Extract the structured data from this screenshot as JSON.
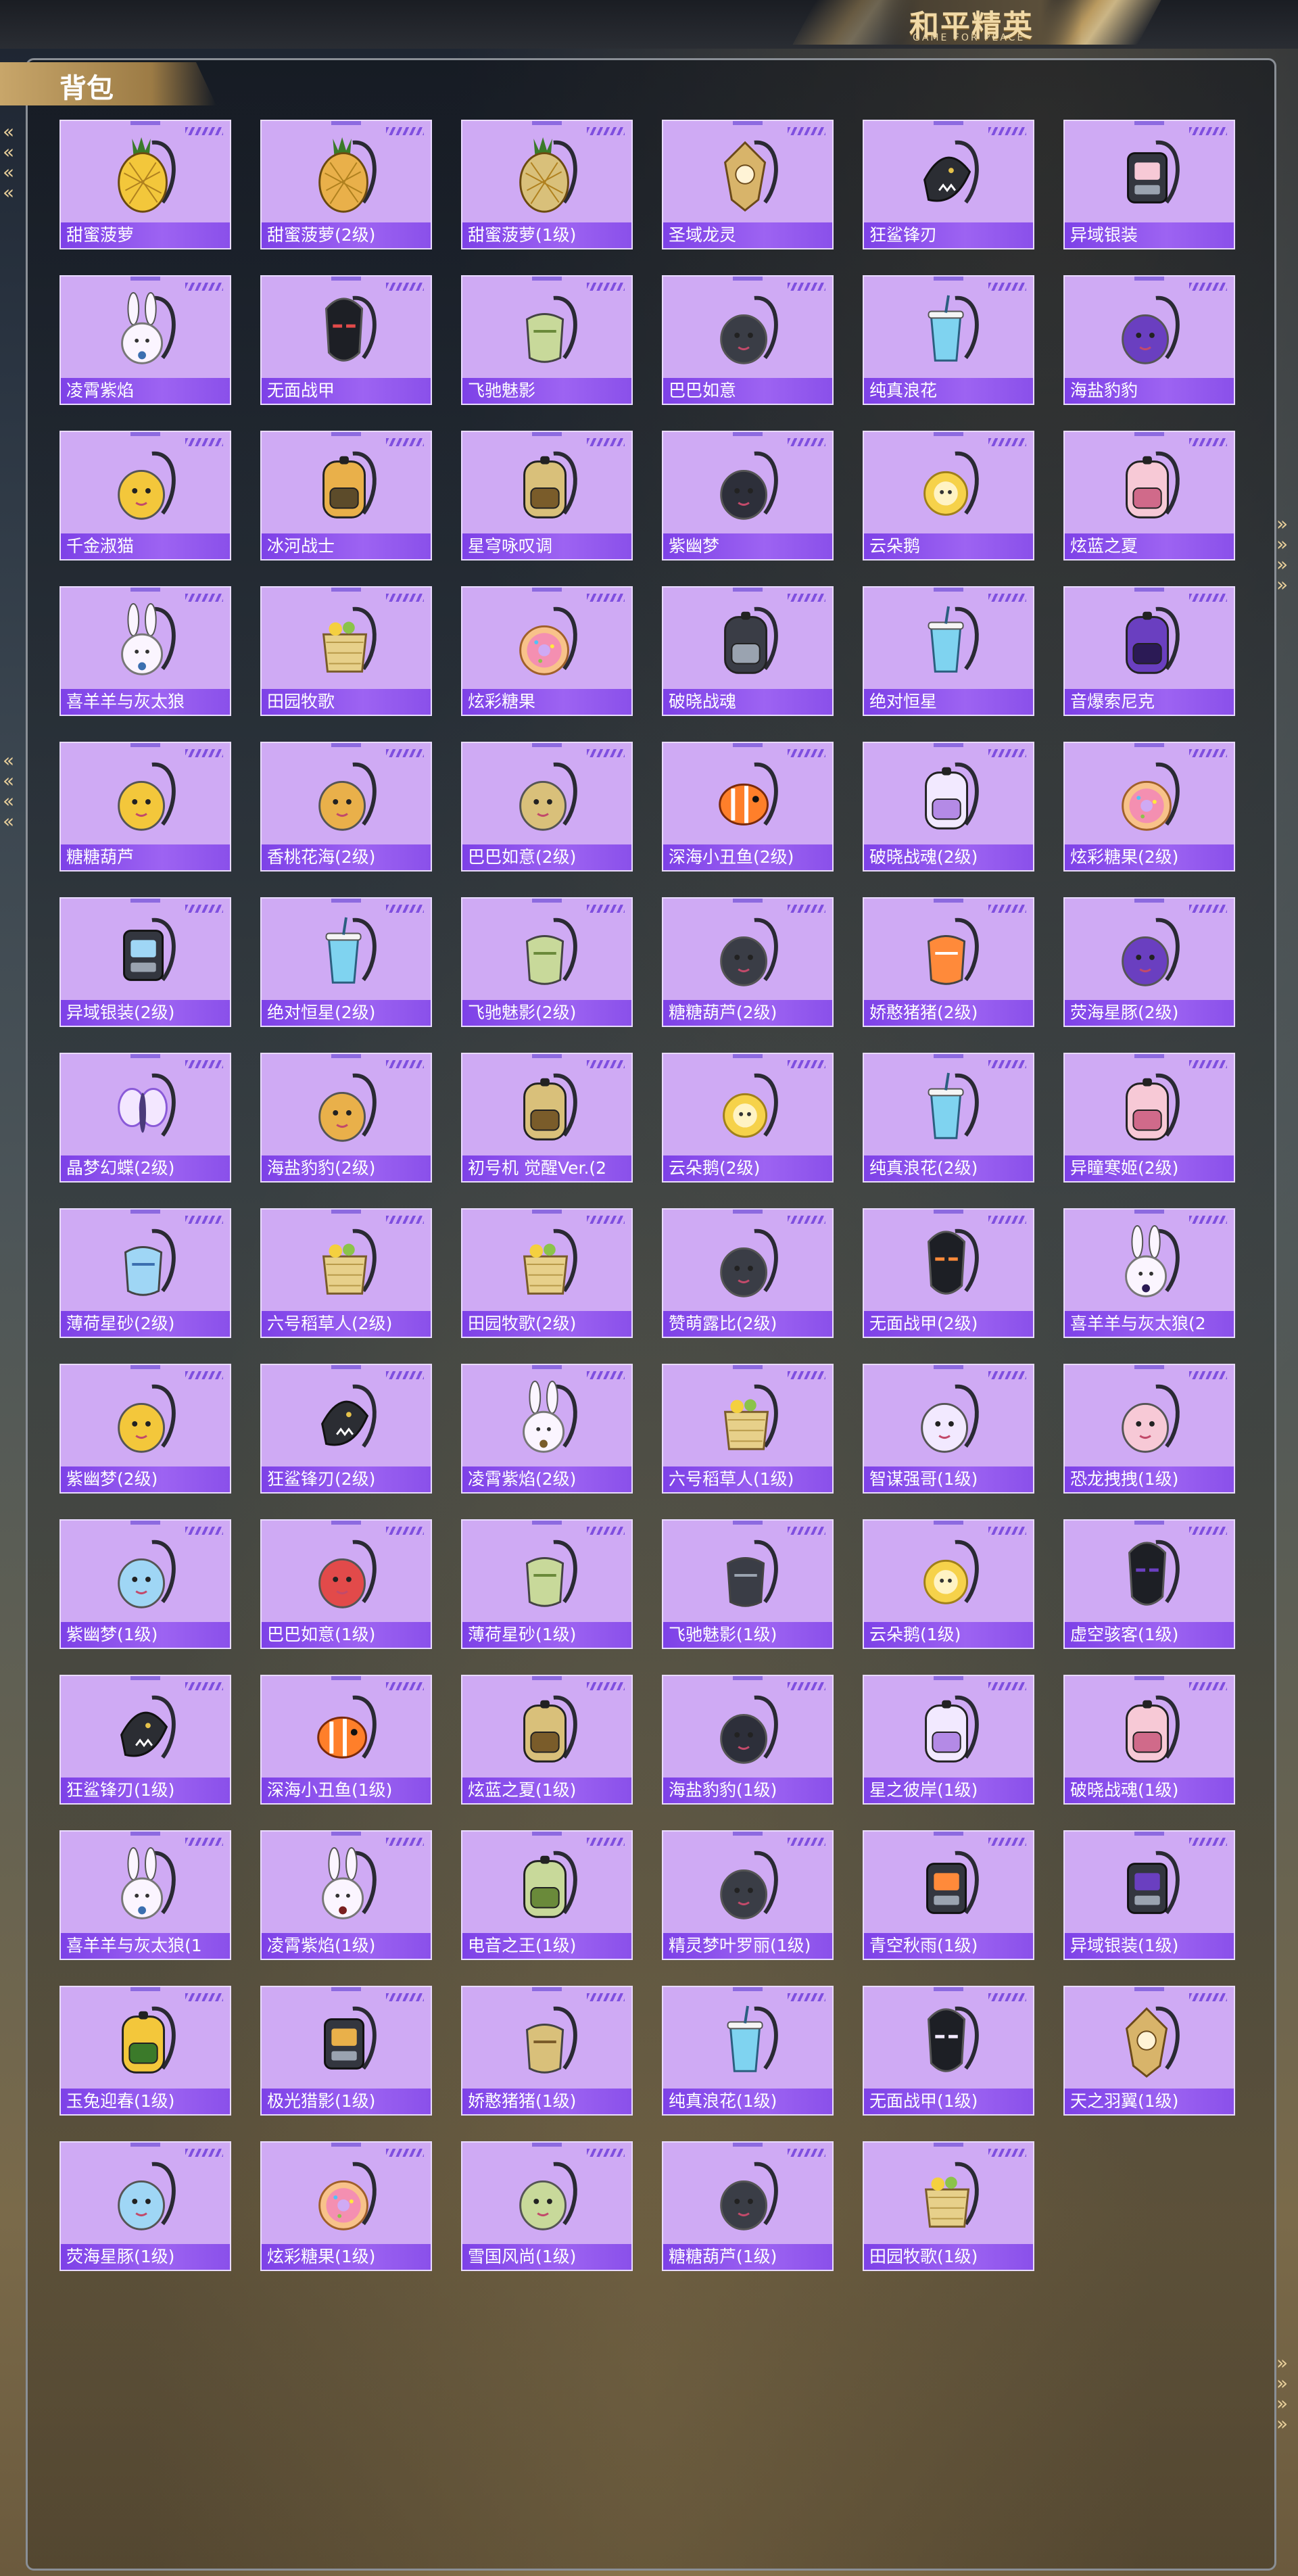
{
  "header": {
    "logo_title": "和平精英",
    "logo_subtitle": "GAME FOR PEACE",
    "section_title": "背包"
  },
  "colors": {
    "card_bg": "#cfaaf4",
    "label_bar": "#8448ea",
    "accent_gold": "#d6b06a"
  },
  "items": [
    {
      "name": "甜蜜菠萝",
      "shape": "pineapple"
    },
    {
      "name": "甜蜜菠萝(2级)",
      "shape": "pineapple"
    },
    {
      "name": "甜蜜菠萝(1级)",
      "shape": "pineapple"
    },
    {
      "name": "圣域龙灵",
      "shape": "ornament"
    },
    {
      "name": "狂鲨锋刃",
      "shape": "shark"
    },
    {
      "name": "异域银装",
      "shape": "tech"
    },
    {
      "name": "凌霄紫焰",
      "shape": "bunny"
    },
    {
      "name": "无面战甲",
      "shape": "mask"
    },
    {
      "name": "飞驰魅影",
      "shape": "pouch"
    },
    {
      "name": "巴巴如意",
      "shape": "blob"
    },
    {
      "name": "纯真浪花",
      "shape": "cup"
    },
    {
      "name": "海盐豹豹",
      "shape": "blob"
    },
    {
      "name": "千金淑猫",
      "shape": "blob"
    },
    {
      "name": "冰河战士",
      "shape": "backpack"
    },
    {
      "name": "星穹咏叹调",
      "shape": "backpack"
    },
    {
      "name": "紫幽梦",
      "shape": "blob"
    },
    {
      "name": "云朵鹅",
      "shape": "flower"
    },
    {
      "name": "炫蓝之夏",
      "shape": "backpack"
    },
    {
      "name": "喜羊羊与灰太狼",
      "shape": "bunny"
    },
    {
      "name": "田园牧歌",
      "shape": "basket"
    },
    {
      "name": "炫彩糖果",
      "shape": "donut"
    },
    {
      "name": "破晓战魂",
      "shape": "backpack"
    },
    {
      "name": "绝对恒星",
      "shape": "cup"
    },
    {
      "name": "音爆索尼克",
      "shape": "backpack"
    },
    {
      "name": "糖糖葫芦",
      "shape": "blob"
    },
    {
      "name": "香桃花海(2级)",
      "shape": "blob"
    },
    {
      "name": "巴巴如意(2级)",
      "shape": "blob"
    },
    {
      "name": "深海小丑鱼(2级)",
      "shape": "fish"
    },
    {
      "name": "破晓战魂(2级)",
      "shape": "backpack"
    },
    {
      "name": "炫彩糖果(2级)",
      "shape": "donut"
    },
    {
      "name": "异域银装(2级)",
      "shape": "tech"
    },
    {
      "name": "绝对恒星(2级)",
      "shape": "cup"
    },
    {
      "name": "飞驰魅影(2级)",
      "shape": "pouch"
    },
    {
      "name": "糖糖葫芦(2级)",
      "shape": "blob"
    },
    {
      "name": "娇憨猪猪(2级)",
      "shape": "pouch"
    },
    {
      "name": "荧海星豚(2级)",
      "shape": "blob"
    },
    {
      "name": "晶梦幻蝶(2级)",
      "shape": "butterfly"
    },
    {
      "name": "海盐豹豹(2级)",
      "shape": "blob"
    },
    {
      "name": "初号机 觉醒Ver.(2",
      "shape": "backpack"
    },
    {
      "name": "云朵鹅(2级)",
      "shape": "flower"
    },
    {
      "name": "纯真浪花(2级)",
      "shape": "cup"
    },
    {
      "name": "异瞳寒姬(2级)",
      "shape": "backpack"
    },
    {
      "name": "薄荷星砂(2级)",
      "shape": "pouch"
    },
    {
      "name": "六号稻草人(2级)",
      "shape": "basket"
    },
    {
      "name": "田园牧歌(2级)",
      "shape": "basket"
    },
    {
      "name": "赞萌露比(2级)",
      "shape": "blob"
    },
    {
      "name": "无面战甲(2级)",
      "shape": "mask"
    },
    {
      "name": "喜羊羊与灰太狼(2",
      "shape": "bunny"
    },
    {
      "name": "紫幽梦(2级)",
      "shape": "blob"
    },
    {
      "name": "狂鲨锋刃(2级)",
      "shape": "shark"
    },
    {
      "name": "凌霄紫焰(2级)",
      "shape": "bunny"
    },
    {
      "name": "六号稻草人(1级)",
      "shape": "basket"
    },
    {
      "name": "智谋强哥(1级)",
      "shape": "blob"
    },
    {
      "name": "恐龙拽拽(1级)",
      "shape": "blob"
    },
    {
      "name": "紫幽梦(1级)",
      "shape": "blob"
    },
    {
      "name": "巴巴如意(1级)",
      "shape": "blob"
    },
    {
      "name": "薄荷星砂(1级)",
      "shape": "pouch"
    },
    {
      "name": "飞驰魅影(1级)",
      "shape": "pouch"
    },
    {
      "name": "云朵鹅(1级)",
      "shape": "flower"
    },
    {
      "name": "虚空骇客(1级)",
      "shape": "mask"
    },
    {
      "name": "狂鲨锋刃(1级)",
      "shape": "shark"
    },
    {
      "name": "深海小丑鱼(1级)",
      "shape": "fish"
    },
    {
      "name": "炫蓝之夏(1级)",
      "shape": "backpack"
    },
    {
      "name": "海盐豹豹(1级)",
      "shape": "blob"
    },
    {
      "name": "星之彼岸(1级)",
      "shape": "backpack"
    },
    {
      "name": "破晓战魂(1级)",
      "shape": "backpack"
    },
    {
      "name": "喜羊羊与灰太狼(1",
      "shape": "bunny"
    },
    {
      "name": "凌霄紫焰(1级)",
      "shape": "bunny"
    },
    {
      "name": "电音之王(1级)",
      "shape": "backpack"
    },
    {
      "name": "精灵梦叶罗丽(1级)",
      "shape": "blob"
    },
    {
      "name": "青空秋雨(1级)",
      "shape": "tech"
    },
    {
      "name": "异域银装(1级)",
      "shape": "tech"
    },
    {
      "name": "玉兔迎春(1级)",
      "shape": "backpack"
    },
    {
      "name": "极光猎影(1级)",
      "shape": "tech"
    },
    {
      "name": "娇憨猪猪(1级)",
      "shape": "pouch"
    },
    {
      "name": "纯真浪花(1级)",
      "shape": "cup"
    },
    {
      "name": "无面战甲(1级)",
      "shape": "mask"
    },
    {
      "name": "天之羽翼(1级)",
      "shape": "ornament"
    },
    {
      "name": "荧海星豚(1级)",
      "shape": "blob"
    },
    {
      "name": "炫彩糖果(1级)",
      "shape": "donut"
    },
    {
      "name": "雪国风尚(1级)",
      "shape": "blob"
    },
    {
      "name": "糖糖葫芦(1级)",
      "shape": "blob"
    },
    {
      "name": "田园牧歌(1级)",
      "shape": "basket"
    }
  ]
}
